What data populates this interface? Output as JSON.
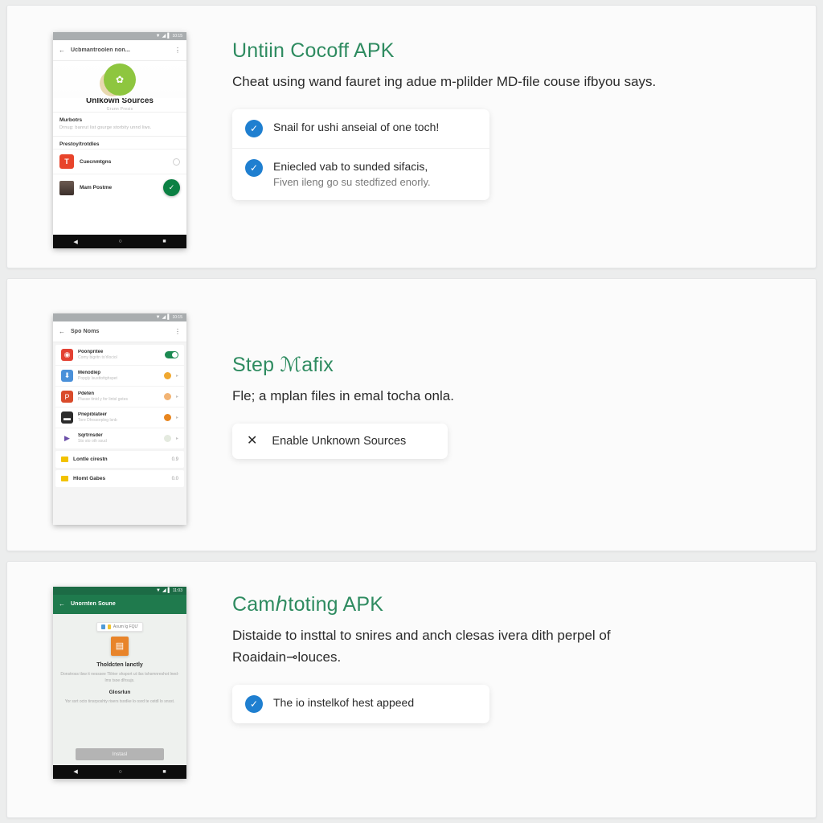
{
  "theme": {
    "accent_green": "#2e8b60",
    "check_blue": "#1f7fd0",
    "page_bg": "#eceded",
    "card_bg": "#fbfbfb"
  },
  "cards": [
    {
      "heading": "Untiin Cocoff APK",
      "body": "Cheat using wand fauret ing adue m-plilder MD-file couse ifbyou says.",
      "checklist": [
        {
          "line1": "Snail for ushi anѕeial of one toch!",
          "line2": ""
        },
        {
          "line1": "Eniecled vab to sunded sifacis,",
          "line2": "Fiven ileng go su stedfized enorly."
        }
      ],
      "phone": {
        "statusbar": {
          "wifi": "▼",
          "signal": "◢",
          "battery": "▌",
          "time": "10:15"
        },
        "appbar": {
          "back_icon": "←",
          "title": "Ucbmantroolen non...",
          "overflow_icon": "⋮"
        },
        "hero_title": "Unlkown Sources",
        "hero_subtitle": "Grunn Presis",
        "section_heading": "Murbotrs",
        "section_body": "Drnug: banrut list gsurge storbity unnd liws.",
        "list_heading": "Prestoy/trotdles",
        "rows": [
          {
            "icon_letter": "T",
            "name": "Cuecnmtgns",
            "trailing": "ring"
          },
          {
            "icon_letter": "",
            "name": "Mam Postme",
            "trailing": "fab"
          }
        ],
        "fab_icon": "✓",
        "navbar": {
          "back": "◀",
          "home": "○",
          "recents": "■"
        }
      }
    },
    {
      "heading": "Step ℳafix",
      "body": "Fle; a mplan files in emal tocha onla.",
      "pill": {
        "icon": "✕",
        "label": "Enable Unknown Sources"
      },
      "phone": {
        "statusbar": {
          "wifi": "▼",
          "signal": "◢",
          "battery": "▌",
          "time": "10:15"
        },
        "appbar": {
          "back_icon": "←",
          "title": "Spo Noms",
          "overflow_icon": "⋮"
        },
        "rows": [
          {
            "title": "Poonpritee",
            "subtitle": "Comy bigritn to'rllociol",
            "trailing": "toggle",
            "icon_color": "#e34133",
            "icon_glyph": "◉"
          },
          {
            "title": "Menodlep",
            "subtitle": "Popgly lsusttottghspet",
            "trailing": "dot",
            "icon_color": "#4a90d9",
            "icon_glyph": "⬇",
            "dot_color": "#f0a830"
          },
          {
            "title": "Pdeten",
            "subtitle": "Plusse tintd y for lintsl gotes",
            "trailing": "dot-chev",
            "icon_color": "#d94b2b",
            "icon_glyph": "P",
            "dot_color": "#f2b474"
          },
          {
            "title": "Pnepiblateer",
            "subtitle": "Tore Dhrssorpleg lsnb",
            "trailing": "dot-chev",
            "icon_color": "#2b2b2b",
            "icon_glyph": "▬",
            "dot_color": "#e8861f"
          },
          {
            "title": "Sqrtrnsder",
            "subtitle": "Sto sto oth ssud",
            "trailing": "dot-chev",
            "icon_color": "#ffffff",
            "icon_glyph": "▶",
            "dot_color": "#dfe6dc"
          }
        ],
        "simple_rows": [
          {
            "title": "Lontle cirestn",
            "value": "0.9"
          },
          {
            "title": "Hlomt Gabes",
            "value": "0.0"
          }
        ]
      }
    },
    {
      "heading": "Camℎtoting APK",
      "body": "Distaide to insttal to snires and anch clesas ivera dith perpel of Roaidain⊸louces.",
      "checklist": [
        {
          "line1": "The io instelkof hest appeed",
          "line2": ""
        }
      ],
      "phone": {
        "statusbar": {
          "wifi": "▼",
          "signal": "◢",
          "battery": "▌",
          "time": "11:03"
        },
        "appbar": {
          "back_icon": "←",
          "title": "Unornten Soune"
        },
        "chip_label": "Aoum  lg  FQU'",
        "package_glyph": "▤",
        "p3_heading": "Tholdcten lanctly",
        "p3_body": "Donstross tlsw it nesssee Tlilrier shsport ut ilss tshsmnreshot lned-lms tsoe dlhsujs.",
        "p3_heading2": "Glosrlun",
        "p3_body2": "Yor ssrt octo tinsrposhty risers tsodke lo osrd te ostdl lo snsst.",
        "install_label": "Instasl",
        "navbar": {
          "back": "◀",
          "home": "○",
          "recents": "■"
        }
      }
    }
  ]
}
